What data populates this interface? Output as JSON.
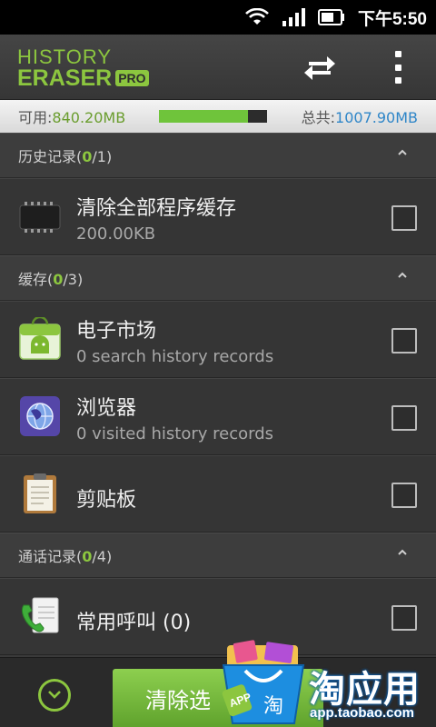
{
  "status_bar": {
    "time": "下午5:50"
  },
  "header": {
    "logo_line1": "HISTORY",
    "logo_line2": "ERASER",
    "logo_badge": "PRO",
    "sync_icon": "sync-icon",
    "menu_icon": "overflow-menu-icon"
  },
  "storage": {
    "available_label": "可用:",
    "available_value": "840.20MB",
    "total_label": "总共:",
    "total_value": "1007.90MB",
    "used_fraction": 0.82
  },
  "sections": [
    {
      "prefix": "历史记录(",
      "selected": "0",
      "total_text": "/1)"
    },
    {
      "prefix": "缓存(",
      "selected": "0",
      "total_text": "/3)"
    },
    {
      "prefix": "通话记录(",
      "selected": "0",
      "total_text": "/4)"
    }
  ],
  "items": [
    {
      "title": "清除全部程序缓存",
      "subtitle": "200.00KB",
      "icon": "memory-chip-icon"
    },
    {
      "title": "电子市场",
      "subtitle": "0 search history records",
      "icon": "android-market-icon"
    },
    {
      "title": "浏览器",
      "subtitle": "0 visited history records",
      "icon": "browser-globe-icon"
    },
    {
      "title": "剪贴板",
      "subtitle": "",
      "icon": "clipboard-icon"
    },
    {
      "title": "常用呼叫 (0)",
      "subtitle": "",
      "icon": "call-log-icon"
    }
  ],
  "bottom": {
    "clear_button": "清除选"
  },
  "watermark": {
    "brand": "淘应用",
    "url": "app.taobao.com",
    "app_badge": "APP",
    "bag_char": "淘"
  },
  "colors": {
    "accent_green": "#8cc63f",
    "total_blue": "#2f86c8",
    "background": "#3a3a3a"
  }
}
